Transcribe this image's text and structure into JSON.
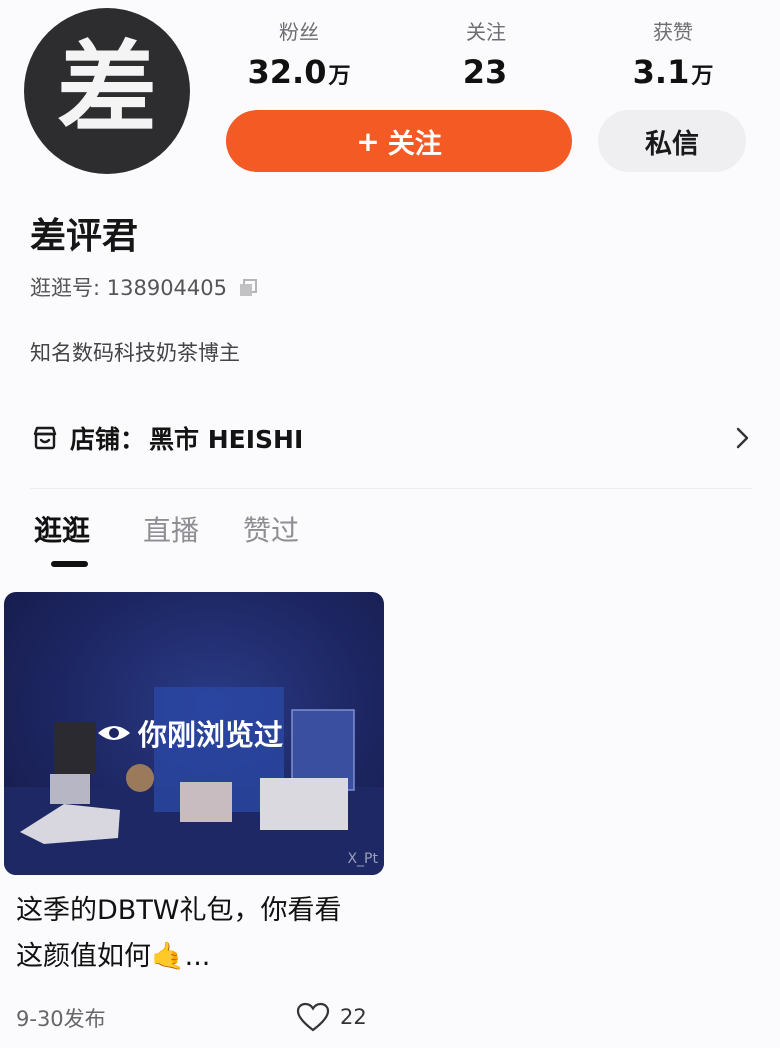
{
  "profile": {
    "avatar_char": "差",
    "name": "差评君",
    "uid_label": "逛逛号: 138904405",
    "bio": "知名数码科技奶茶博主"
  },
  "stats": [
    {
      "label": "粉丝",
      "value": "32.0",
      "unit": "万"
    },
    {
      "label": "关注",
      "value": "23",
      "unit": ""
    },
    {
      "label": "获赞",
      "value": "3.1",
      "unit": "万"
    }
  ],
  "actions": {
    "follow_plus": "+",
    "follow_label": "关注",
    "message_label": "私信"
  },
  "shop": {
    "label": "店铺：",
    "name": "黑市 HEISHI"
  },
  "tabs": [
    {
      "label": "逛逛",
      "active": true
    },
    {
      "label": "直播",
      "active": false
    },
    {
      "label": "赞过",
      "active": false
    }
  ],
  "posts": [
    {
      "badge": "你刚浏览过",
      "watermark": "X_Pt",
      "title": "这季的DBTW礼包，你看看这颜值如何🤙...",
      "date": "9-30发布",
      "likes": "22"
    }
  ],
  "colors": {
    "accent": "#f45a24",
    "image_bg": "#1c2560"
  },
  "icons": [
    "copy-icon",
    "shop-icon",
    "chevron-right-icon",
    "eye-icon",
    "heart-icon"
  ]
}
